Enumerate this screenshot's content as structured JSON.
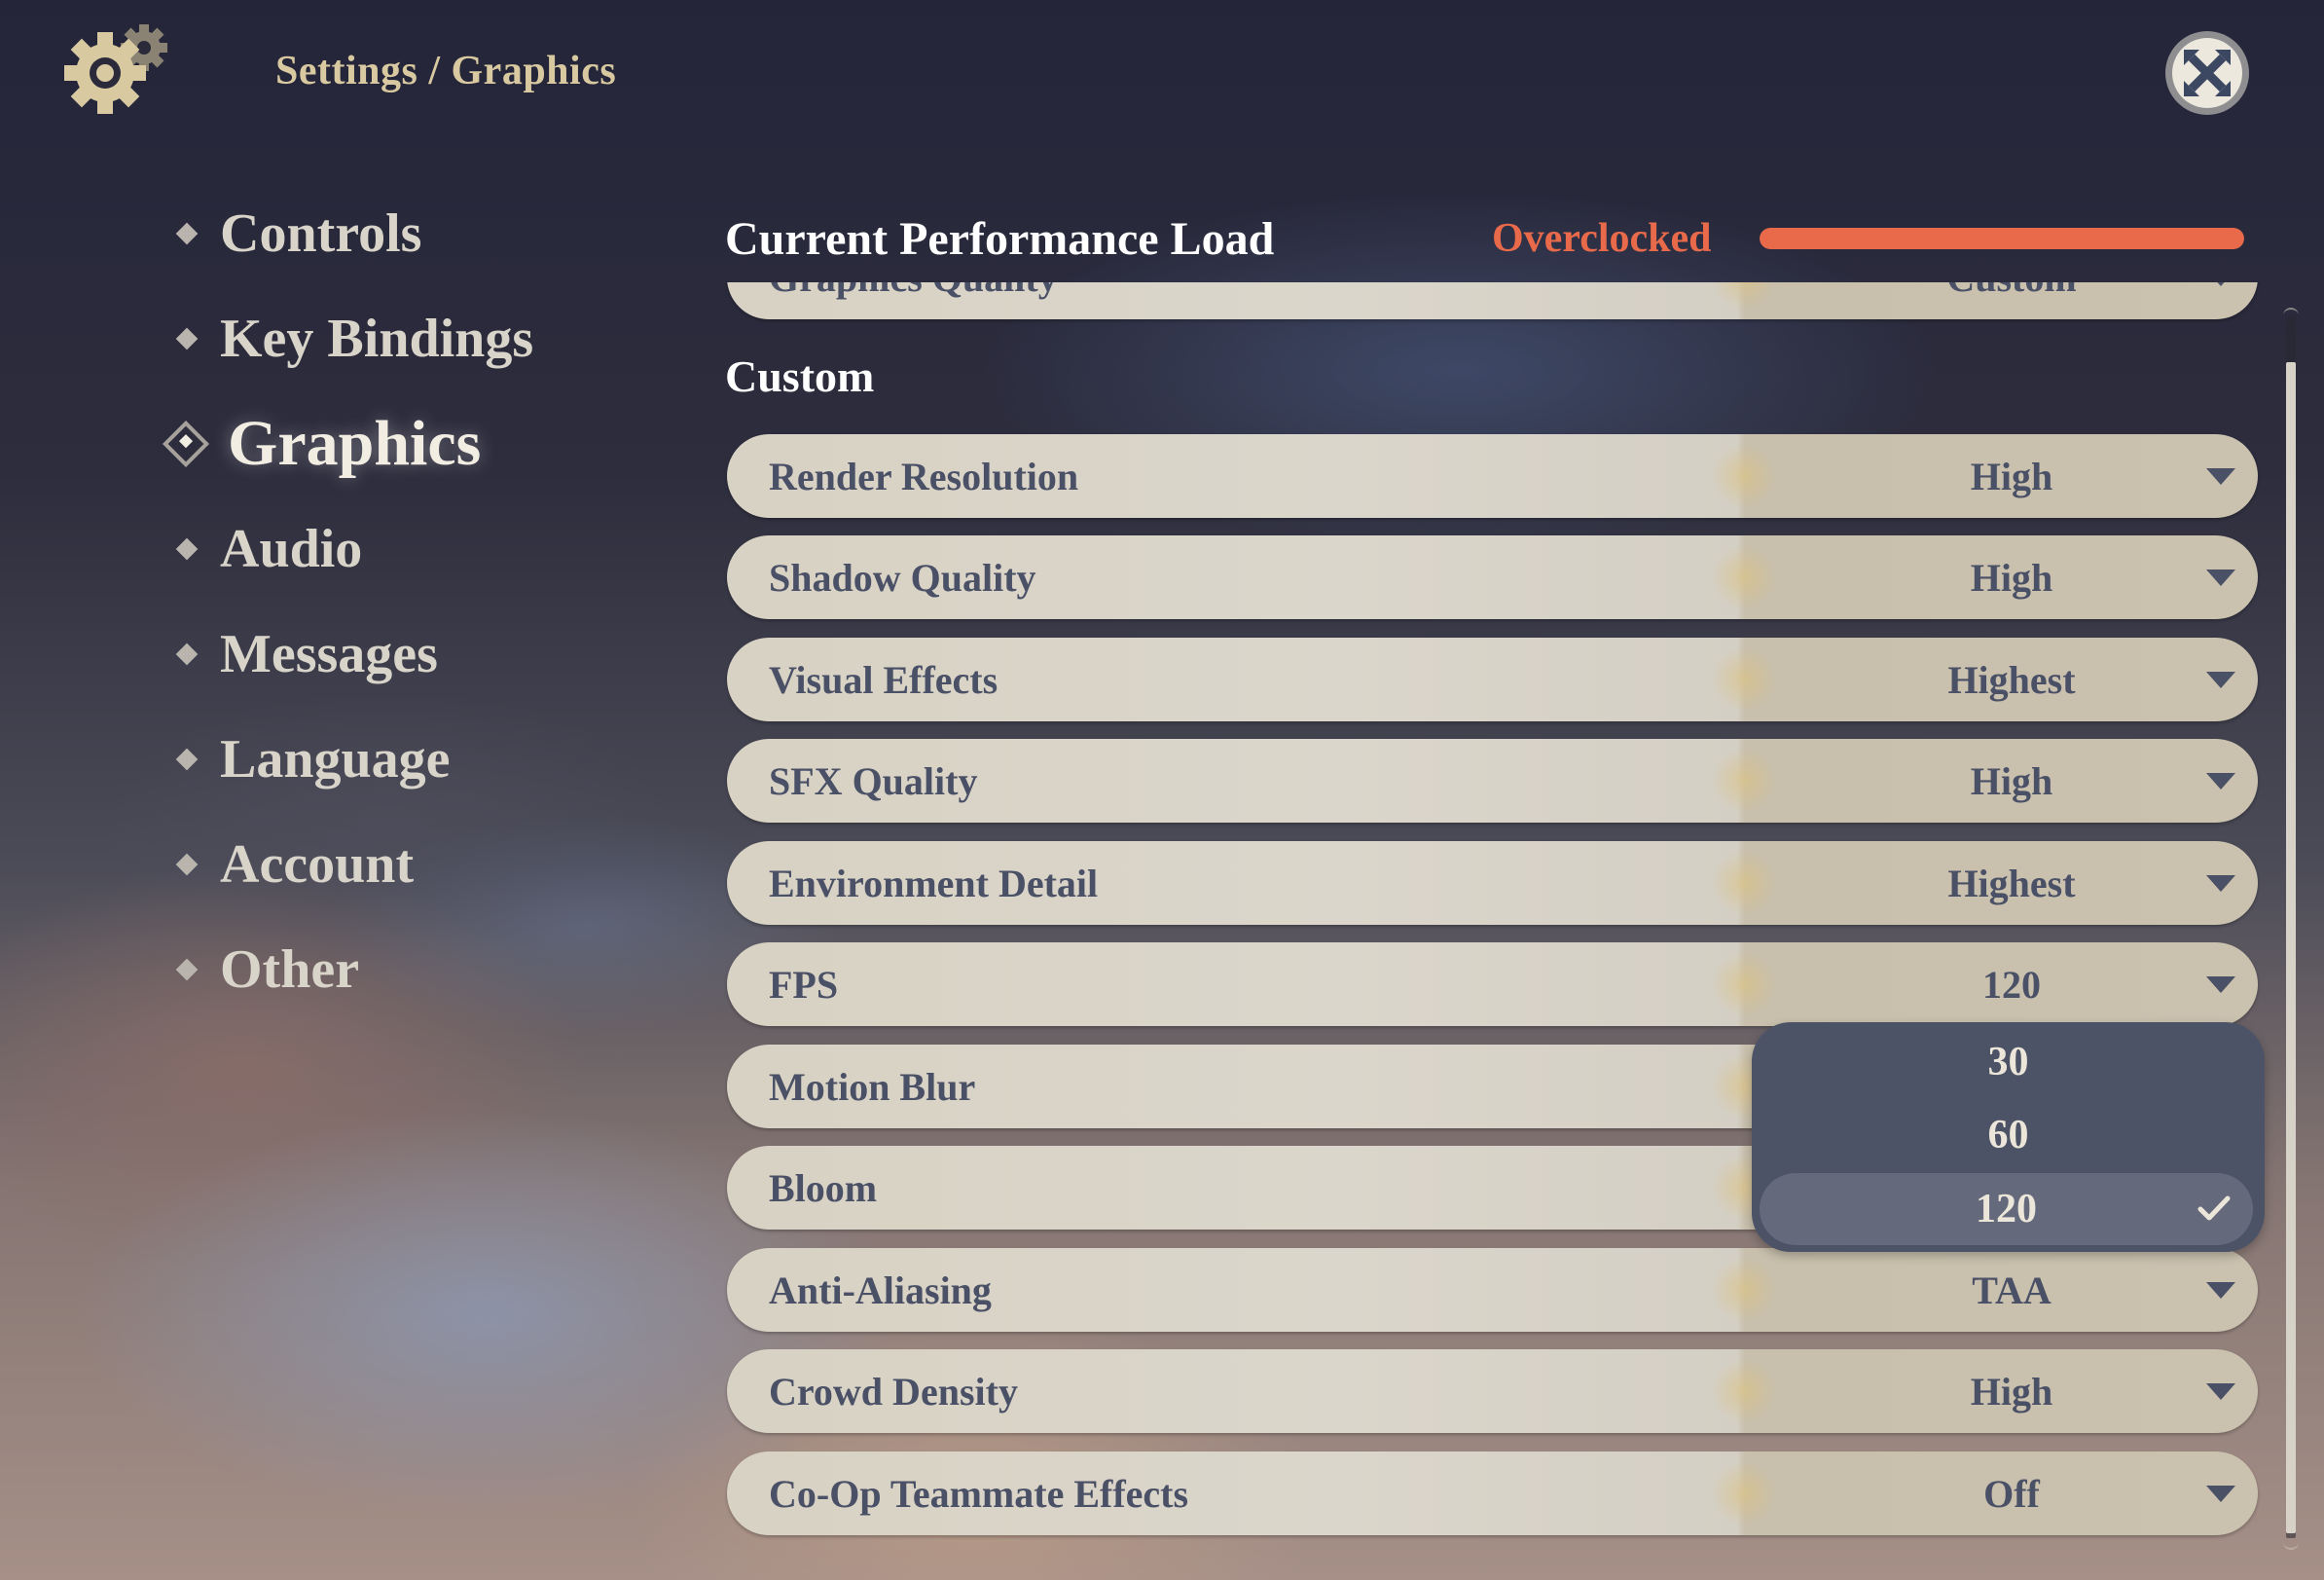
{
  "header": {
    "breadcrumb": "Settings / Graphics",
    "icon": "gear-icon",
    "close_icon": "close-icon"
  },
  "sidebar": {
    "items": [
      {
        "label": "Controls",
        "active": false
      },
      {
        "label": "Key Bindings",
        "active": false
      },
      {
        "label": "Graphics",
        "active": true
      },
      {
        "label": "Audio",
        "active": false
      },
      {
        "label": "Messages",
        "active": false
      },
      {
        "label": "Language",
        "active": false
      },
      {
        "label": "Account",
        "active": false
      },
      {
        "label": "Other",
        "active": false
      }
    ]
  },
  "performance": {
    "title": "Current Performance Load",
    "status": "Overclocked",
    "load_percent": 100,
    "status_color": "#e96a4b"
  },
  "settings": {
    "partial_row": {
      "label": "Graphics Quality",
      "value": "Custom"
    },
    "section_title": "Custom",
    "rows": [
      {
        "label": "Render Resolution",
        "value": "High"
      },
      {
        "label": "Shadow Quality",
        "value": "High"
      },
      {
        "label": "Visual Effects",
        "value": "Highest"
      },
      {
        "label": "SFX Quality",
        "value": "High"
      },
      {
        "label": "Environment Detail",
        "value": "Highest"
      },
      {
        "label": "FPS",
        "value": "120"
      },
      {
        "label": "Motion Blur",
        "value": ""
      },
      {
        "label": "Bloom",
        "value": ""
      },
      {
        "label": "Anti-Aliasing",
        "value": "TAA"
      },
      {
        "label": "Crowd Density",
        "value": "High"
      },
      {
        "label": "Co-Op Teammate Effects",
        "value": "Off"
      }
    ]
  },
  "fps_dropdown": {
    "options": [
      "30",
      "60",
      "120"
    ],
    "selected": "120"
  },
  "colors": {
    "accent_text": "#d8c9a0",
    "row_text": "#4a5066",
    "dropdown_bg": "#4c5366",
    "overclocked": "#e96a4b"
  }
}
